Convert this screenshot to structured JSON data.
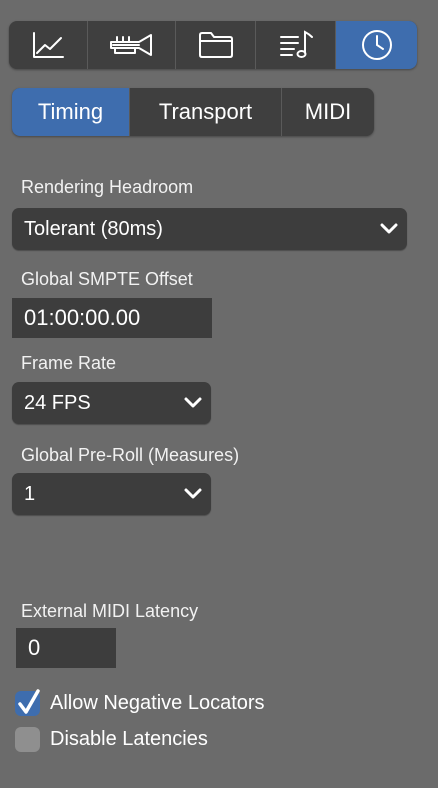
{
  "toolbar": {
    "icons": [
      {
        "name": "chart-icon",
        "active": false
      },
      {
        "name": "trumpet-icon",
        "active": false
      },
      {
        "name": "folder-icon",
        "active": false
      },
      {
        "name": "score-note-icon",
        "active": false
      },
      {
        "name": "clock-icon",
        "active": true
      }
    ],
    "accent_color": "#3e6dae"
  },
  "tabs": [
    {
      "label": "Timing",
      "active": true
    },
    {
      "label": "Transport",
      "active": false
    },
    {
      "label": "MIDI",
      "active": false
    }
  ],
  "rendering_headroom": {
    "label": "Rendering Headroom",
    "selected": "Tolerant (80ms)"
  },
  "smpte_offset": {
    "label": "Global SMPTE Offset",
    "value": "01:00:00.00"
  },
  "frame_rate": {
    "label": "Frame Rate",
    "selected": "24 FPS"
  },
  "pre_roll": {
    "label": "Global Pre-Roll (Measures)",
    "selected": "1"
  },
  "midi_latency": {
    "label": "External MIDI Latency",
    "value": "0"
  },
  "checkboxes": [
    {
      "label": "Allow Negative Locators",
      "checked": true
    },
    {
      "label": "Disable Latencies",
      "checked": false
    }
  ]
}
